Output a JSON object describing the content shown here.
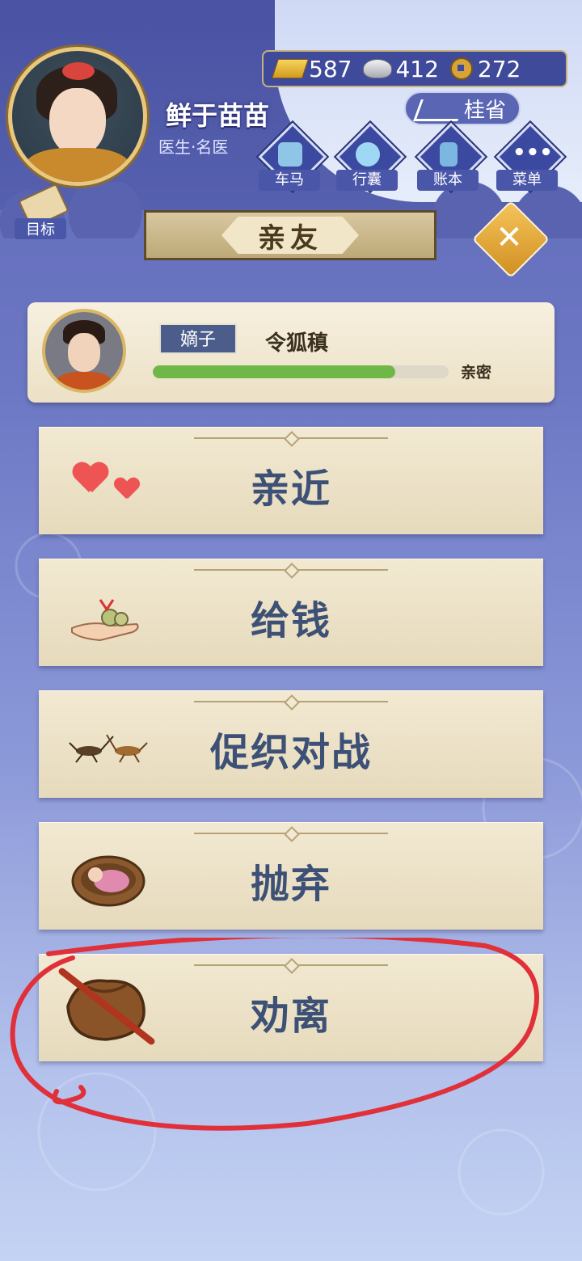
{
  "player": {
    "name": "鲜于苗苗",
    "title": "医生·名医"
  },
  "currency": {
    "gold": "587",
    "silver": "412",
    "coin": "272"
  },
  "guixing_label": "桂省",
  "nav": [
    {
      "label": "车马",
      "icon": "carriage-icon"
    },
    {
      "label": "行囊",
      "icon": "bundle-icon"
    },
    {
      "label": "账本",
      "icon": "ledger-icon"
    },
    {
      "label": "菜单",
      "icon": "menu-dots-icon"
    }
  ],
  "goal_label": "目标",
  "banner_title": "亲友",
  "relative": {
    "tag": "嫡子",
    "name": "令狐稹",
    "intimacy_label": "亲密",
    "intimacy_fraction": 0.82
  },
  "actions": [
    {
      "label": "亲近",
      "icon": "hearts-icon"
    },
    {
      "label": "给钱",
      "icon": "money-hand-icon"
    },
    {
      "label": "促织对战",
      "icon": "crickets-icon"
    },
    {
      "label": "抛弃",
      "icon": "baby-basket-icon"
    },
    {
      "label": "劝离",
      "icon": "travel-bundle-icon"
    }
  ],
  "colors": {
    "accent": "#3d5075",
    "annotation": "#e0303a",
    "progress": "#6fb847"
  }
}
